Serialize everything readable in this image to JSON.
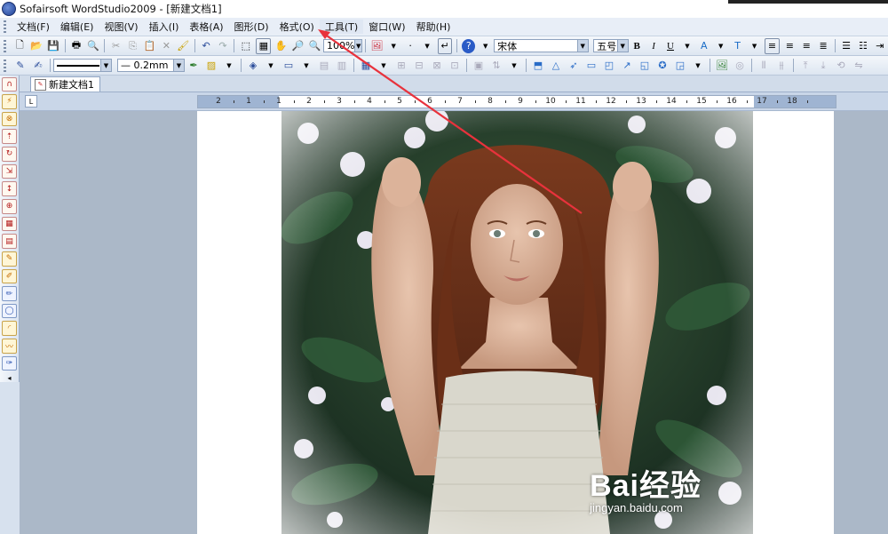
{
  "window": {
    "title": "Sofairsoft WordStudio2009 - [新建文档1]"
  },
  "menubar": {
    "items": [
      {
        "label": "文档(F)"
      },
      {
        "label": "编辑(E)"
      },
      {
        "label": "视图(V)"
      },
      {
        "label": "插入(I)"
      },
      {
        "label": "表格(A)"
      },
      {
        "label": "图形(D)"
      },
      {
        "label": "格式(O)"
      },
      {
        "label": "工具(T)"
      },
      {
        "label": "窗口(W)"
      },
      {
        "label": "帮助(H)"
      }
    ]
  },
  "toolbar": {
    "zoom_value": "100%",
    "font_name": "宋体",
    "font_size": "五号",
    "bold_label": "B",
    "italic_label": "I",
    "underline_label": "U"
  },
  "drawing_toolbar": {
    "line_width": "— 0.2mm"
  },
  "tabs": {
    "active_document": "新建文档1"
  },
  "ruler": {
    "labels": [
      "2",
      "1",
      "1",
      "2",
      "3",
      "4",
      "5",
      "6",
      "7",
      "8",
      "9",
      "10",
      "11",
      "12",
      "13",
      "14",
      "15",
      "16",
      "17",
      "18"
    ]
  },
  "watermark": {
    "brand": "Bai经验",
    "url": "jingyan.baidu.com"
  },
  "colors": {
    "annotation_arrow": "#e8323c",
    "menu_bg": "#e8eef7",
    "canvas_bg": "#abb8c8"
  }
}
